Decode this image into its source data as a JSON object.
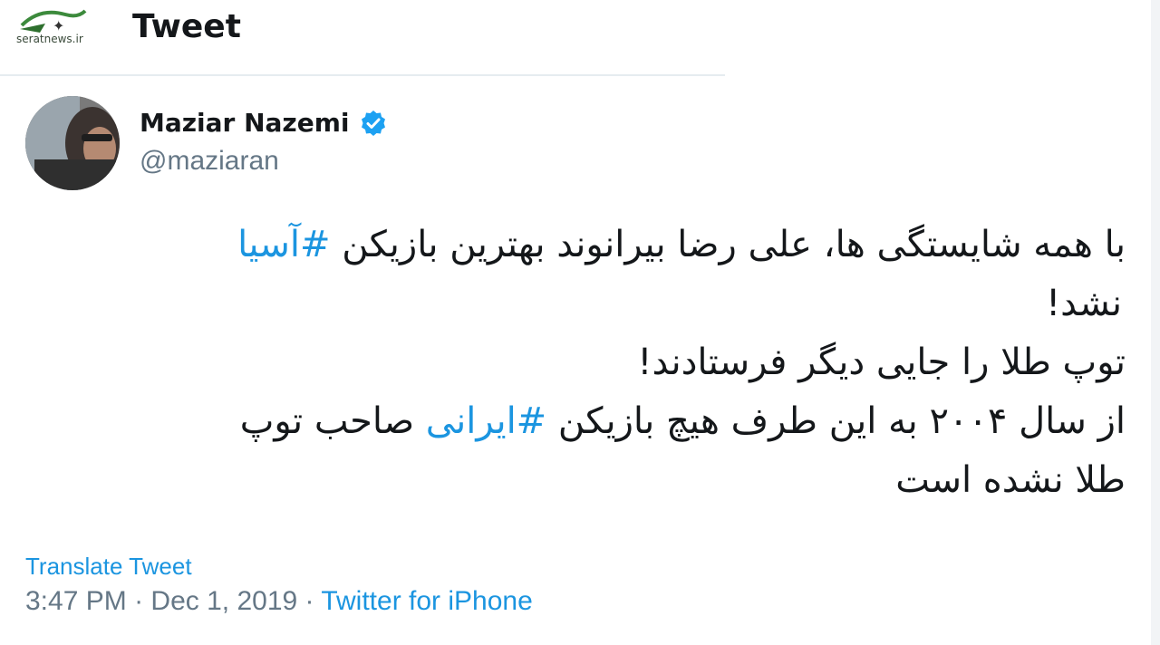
{
  "header": {
    "title": "Tweet",
    "watermark_text": "seratnews.ir"
  },
  "author": {
    "name": "Maziar Nazemi",
    "handle": "@maziaran",
    "verified": true
  },
  "tweet": {
    "line1_text": "با همه شایستگی ها، علی رضا بیرانوند بهترین بازیکن ",
    "line1_hashtag": "#آسیا",
    "line2": "نشد!",
    "line3": "توپ طلا را جایی دیگر  فرستادند!",
    "line4_before": "از سال ۲۰۰۴ به این طرف هیچ بازیکن ",
    "line4_hashtag": "#ایرانی",
    "line4_after": " صاحب توپ",
    "line5": "طلا نشده است"
  },
  "footer": {
    "translate_label": "Translate Tweet",
    "time": "3:47 PM",
    "separator": "·",
    "date": "Dec 1, 2019",
    "source": "Twitter for iPhone"
  },
  "colors": {
    "link": "#1b95e0",
    "muted": "#657786",
    "text": "#14171a",
    "verified_badge": "#1da1f2"
  },
  "icons": {
    "verified": "verified-badge-icon"
  }
}
